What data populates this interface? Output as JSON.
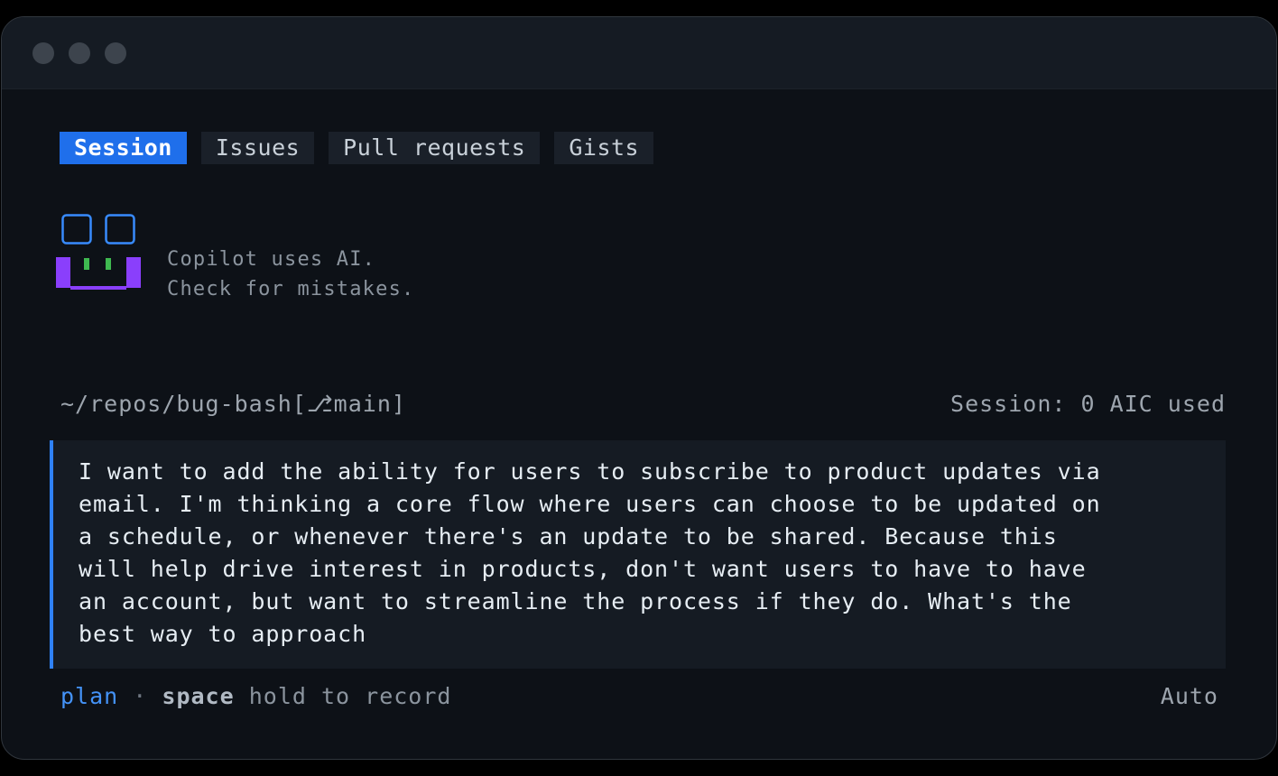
{
  "tabs": [
    {
      "label": "Session",
      "active": true
    },
    {
      "label": "Issues",
      "active": false
    },
    {
      "label": "Pull requests",
      "active": false
    },
    {
      "label": "Gists",
      "active": false
    }
  ],
  "notice": {
    "line1": "Copilot uses AI.",
    "line2": "Check for mistakes."
  },
  "status": {
    "path": "~/repos/bug-bash[⎇main]",
    "usage": "Session: 0 AIC used"
  },
  "prompt": {
    "text": "I want to add the ability for users to subscribe to product updates via\nemail. I'm thinking a core flow where users can choose to be updated on\na schedule, or whenever there's an update to be shared. Because this\nwill help drive interest in products, don't want users to have to have\nan account, but want to streamline the process if they do. What's the\nbest way to approach"
  },
  "footer": {
    "mode": "plan",
    "separator": "·",
    "key": "space",
    "hint": "hold to record",
    "model": "Auto"
  },
  "colors": {
    "accent": "#1f6feb",
    "prompt_border": "#2f81f7",
    "mascot_eyes": "#388bfd",
    "mascot_body": "#8a3ffc",
    "mascot_teeth": "#3fb950"
  },
  "icons": {
    "mascot": "copilot-mascot-icon"
  }
}
